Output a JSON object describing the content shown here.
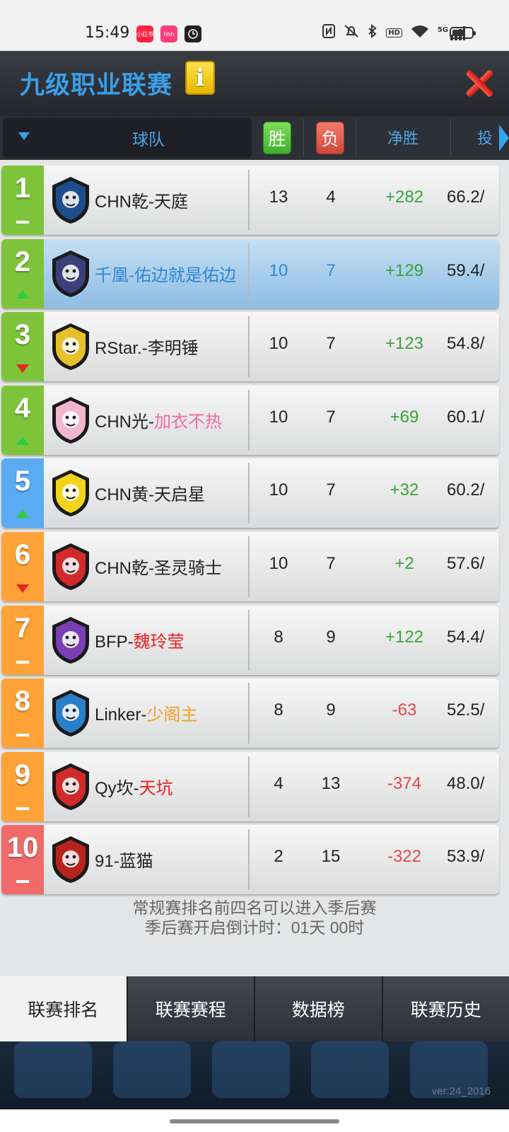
{
  "status_bar": {
    "time": "15:49",
    "apps": [
      {
        "label": "小红书",
        "color": "#ff2442"
      },
      {
        "label": "hhh",
        "color": "#ff3d7a"
      },
      {
        "label": "",
        "color": "#222222"
      }
    ],
    "icons": [
      "nfc-icon",
      "mute-icon",
      "bluetooth-icon",
      "hd-icon",
      "wifi-icon",
      "5g-signal-icon",
      "battery-icon"
    ],
    "hd": "HD",
    "net": "5G"
  },
  "header": {
    "title": "九级职业联赛",
    "info_glyph": "i"
  },
  "columns": {
    "team": "球队",
    "wins": "胜",
    "losses": "负",
    "net": "净胜",
    "pct": "投"
  },
  "rows": [
    {
      "rank": "1",
      "trend": "same",
      "rank_color": "#7dc43a",
      "prefix": "CHN乾-",
      "name": "天庭",
      "name_color": "#222222",
      "wins": "13",
      "losses": "4",
      "net": "+282",
      "net_sign": "pos",
      "pct": "66.2/",
      "logo": "bear-logo",
      "logo_color": "#1b4e8a",
      "highlight": false
    },
    {
      "rank": "2",
      "trend": "up",
      "rank_color": "#7dc43a",
      "prefix": "千凰-",
      "name": "佑边就是佑边",
      "name_color": "#2f87d8",
      "wins": "10",
      "losses": "7",
      "net": "+129",
      "net_sign": "pos",
      "pct": "59.4/",
      "logo": "dragon-logo",
      "logo_color": "#3b3f7a",
      "highlight": true
    },
    {
      "rank": "3",
      "trend": "down",
      "rank_color": "#7dc43a",
      "prefix": "RStar.-",
      "name": "李明锤",
      "name_color": "#222222",
      "wins": "10",
      "losses": "7",
      "net": "+123",
      "net_sign": "pos",
      "pct": "54.8/",
      "logo": "lion-logo",
      "logo_color": "#e5c02a",
      "highlight": false
    },
    {
      "rank": "4",
      "trend": "up",
      "rank_color": "#7dc43a",
      "prefix": "CHN光-",
      "name": "加衣不热",
      "name_color": "#f06aa8",
      "wins": "10",
      "losses": "7",
      "net": "+69",
      "net_sign": "pos",
      "pct": "60.1/",
      "logo": "unicorn-logo",
      "logo_color": "#f3b6cf",
      "highlight": false
    },
    {
      "rank": "5",
      "trend": "up",
      "rank_color": "#5aabf2",
      "prefix": "CHN黄-",
      "name": "天启星",
      "name_color": "#222222",
      "wins": "10",
      "losses": "7",
      "net": "+32",
      "net_sign": "pos",
      "pct": "60.2/",
      "logo": "bear-yellow-logo",
      "logo_color": "#f2d51a",
      "highlight": false
    },
    {
      "rank": "6",
      "trend": "down",
      "rank_color": "#ffa238",
      "prefix": "CHN乾-",
      "name": "圣灵骑士",
      "name_color": "#222222",
      "wins": "10",
      "losses": "7",
      "net": "+2",
      "net_sign": "pos",
      "pct": "57.6/",
      "logo": "knight-logo",
      "logo_color": "#d22a2a",
      "highlight": false
    },
    {
      "rank": "7",
      "trend": "same",
      "rank_color": "#ffa238",
      "prefix": "BFP-",
      "name": "魏玲莹",
      "name_color": "#e82020",
      "wins": "8",
      "losses": "9",
      "net": "+122",
      "net_sign": "pos",
      "pct": "54.4/",
      "logo": "rabbit-logo",
      "logo_color": "#7a3fb5",
      "highlight": false
    },
    {
      "rank": "8",
      "trend": "same",
      "rank_color": "#ffa238",
      "prefix": "Linker-",
      "name": "少阁主",
      "name_color": "#f0a020",
      "wins": "8",
      "losses": "9",
      "net": "-63",
      "net_sign": "neg",
      "pct": "52.5/",
      "logo": "spartan-logo",
      "logo_color": "#2a7fc8",
      "highlight": false
    },
    {
      "rank": "9",
      "trend": "same",
      "rank_color": "#ffa238",
      "prefix": "Qy坎-",
      "name": "天坑",
      "name_color": "#e82020",
      "wins": "4",
      "losses": "13",
      "net": "-374",
      "net_sign": "neg",
      "pct": "48.0/",
      "logo": "ram-logo",
      "logo_color": "#d22a2a",
      "highlight": false
    },
    {
      "rank": "10",
      "trend": "same",
      "rank_color": "#f06a6a",
      "prefix": "91-",
      "name": "蓝猫",
      "name_color": "#222222",
      "wins": "2",
      "losses": "15",
      "net": "-322",
      "net_sign": "neg",
      "pct": "53.9/",
      "logo": "dragon-red-logo",
      "logo_color": "#b8241c",
      "highlight": false
    }
  ],
  "notes": {
    "line1": "常规赛排名前四名可以进入季后赛",
    "line2": "季后赛开启倒计时：01天 00时"
  },
  "tabs": [
    {
      "label": "联赛排名",
      "active": true
    },
    {
      "label": "联赛赛程",
      "active": false
    },
    {
      "label": "数据榜",
      "active": false
    },
    {
      "label": "联赛历史",
      "active": false
    }
  ],
  "footer": {
    "version": "ver:24_2016"
  },
  "colors": {
    "accent": "#3b9ee8",
    "win_badge": "#5cc843",
    "loss_badge": "#e85c4c",
    "positive": "#3aa33a",
    "negative": "#e04848"
  }
}
